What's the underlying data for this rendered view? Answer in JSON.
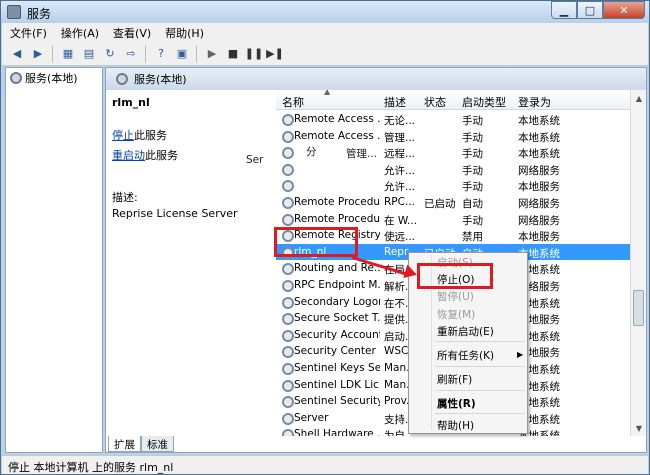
{
  "window": {
    "title": "服务",
    "controls": {
      "minimize": "▁",
      "maximize": "□",
      "close": "✕"
    }
  },
  "menu": [
    "文件(F)",
    "操作(A)",
    "查看(V)",
    "帮助(H)"
  ],
  "toolbar_icons": [
    "back-icon",
    "forward-icon",
    "console-tree-icon",
    "properties-icon",
    "refresh-icon",
    "export-icon",
    "help-icon",
    "console-icon",
    "play-icon",
    "stop-icon",
    "pause-icon",
    "restart-icon"
  ],
  "tree": {
    "root": "服务(本地)"
  },
  "panel": {
    "header": "服务(本地)",
    "service_name": "rlm_nl",
    "stop_link": "停止",
    "stop_suffix": "此服务",
    "restart_link": "重启动",
    "restart_suffix": "此服务",
    "desc_label": "描述:",
    "desc_text": "Reprise License Server"
  },
  "columns": {
    "name": "名称",
    "desc": "描述",
    "state": "状态",
    "start": "启动类型",
    "logon": "登录为"
  },
  "services": [
    {
      "name": "Remote Access ...",
      "desc": "无论...",
      "state": "",
      "start": "手动",
      "logon": "本地系统"
    },
    {
      "name": "Remote Access ...",
      "desc": "管理...",
      "state": "",
      "start": "手动",
      "logon": "本地系统"
    },
    {
      "name": "",
      "desc": "远程...",
      "state": "",
      "start": "手动",
      "logon": "本地系统"
    },
    {
      "name": "",
      "desc": "允许...",
      "state": "",
      "start": "手动",
      "logon": "网络服务"
    },
    {
      "name": "",
      "desc": "允许...",
      "state": "",
      "start": "手动",
      "logon": "本地服务"
    },
    {
      "name": "Remote Procedu...",
      "desc": "RPC...",
      "state": "已启动",
      "start": "自动",
      "logon": "网络服务"
    },
    {
      "name": "Remote Procedu...",
      "desc": "在 W...",
      "state": "",
      "start": "手动",
      "logon": "网络服务"
    },
    {
      "name": "Remote Registry",
      "desc": "使远...",
      "state": "",
      "start": "禁用",
      "logon": "本地服务"
    },
    {
      "name": "rlm_nl",
      "desc": "Repr...",
      "state": "已启动",
      "start": "自动",
      "logon": "本地系统"
    },
    {
      "name": "Routing and Re...",
      "desc": "在局...",
      "state": "",
      "start": "",
      "logon": "本地系统"
    },
    {
      "name": "RPC Endpoint M...",
      "desc": "解析...",
      "state": "",
      "start": "",
      "logon": "网络服务"
    },
    {
      "name": "Secondary Logon",
      "desc": "在不...",
      "state": "",
      "start": "",
      "logon": "本地系统"
    },
    {
      "name": "Secure Socket T...",
      "desc": "提供...",
      "state": "",
      "start": "",
      "logon": "本地服务"
    },
    {
      "name": "Security Account...",
      "desc": "启动...",
      "state": "",
      "start": "",
      "logon": "本地系统"
    },
    {
      "name": "Security Center",
      "desc": "WSC...",
      "state": "",
      "start": "",
      "logon": "本地服务"
    },
    {
      "name": "Sentinel Keys Se...",
      "desc": "Man...",
      "state": "",
      "start": "",
      "logon": "本地系统"
    },
    {
      "name": "Sentinel LDK Lic...",
      "desc": "Man...",
      "state": "",
      "start": "",
      "logon": "本地系统"
    },
    {
      "name": "Sentinel Security...",
      "desc": "Prov...",
      "state": "",
      "start": "",
      "logon": "本地系统"
    },
    {
      "name": "Server",
      "desc": "支持...",
      "state": "",
      "start": "",
      "logon": "本地系统"
    },
    {
      "name": "Shell Hardware ...",
      "desc": "为自...",
      "state": "",
      "start": "",
      "logon": "本地系统"
    }
  ],
  "overlay": {
    "ser": "Ser",
    "fen": "分",
    "guanli": "管理..."
  },
  "context_menu": {
    "start": "启动(S)",
    "stop": "停止(O)",
    "pause": "暂停(U)",
    "resume": "恢复(M)",
    "restart": "重新启动(E)",
    "all_tasks": "所有任务(K)",
    "refresh": "刷新(F)",
    "properties": "属性(R)",
    "help": "帮助(H)"
  },
  "tabs": [
    "扩展",
    "标准"
  ],
  "status": "停止 本地计算机 上的服务 rlm_nl",
  "colors": {
    "selection": "#3399ff",
    "highlight": "#e01a22"
  }
}
